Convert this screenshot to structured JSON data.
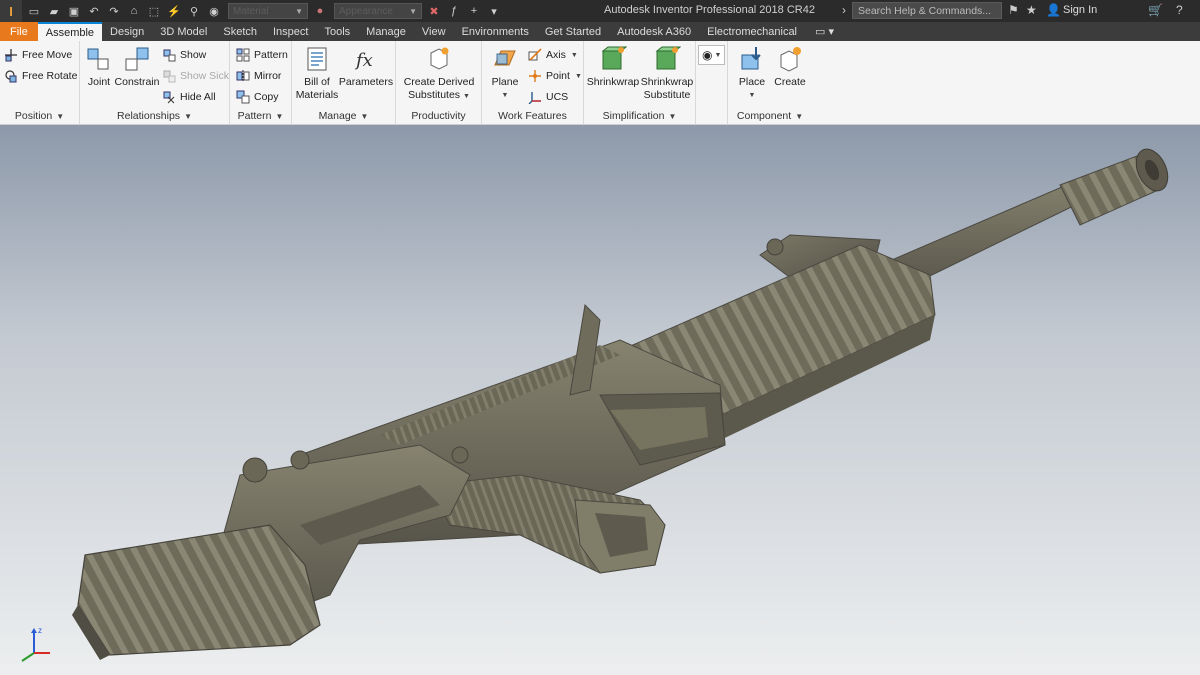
{
  "titlebar": {
    "app_title": "Autodesk Inventor Professional 2018    CR42",
    "search_placeholder": "Search Help & Commands...",
    "signin_label": "Sign In",
    "material_combo": "Material",
    "appearance_combo": "Appearance"
  },
  "tabs": [
    {
      "label": "File"
    },
    {
      "label": "Assemble"
    },
    {
      "label": "Design"
    },
    {
      "label": "3D Model"
    },
    {
      "label": "Sketch"
    },
    {
      "label": "Inspect"
    },
    {
      "label": "Tools"
    },
    {
      "label": "Manage"
    },
    {
      "label": "View"
    },
    {
      "label": "Environments"
    },
    {
      "label": "Get Started"
    },
    {
      "label": "Autodesk A360"
    },
    {
      "label": "Electromechanical"
    }
  ],
  "ribbon": {
    "position": {
      "title": "Position",
      "free_move": "Free Move",
      "free_rotate": "Free Rotate"
    },
    "relationships": {
      "title": "Relationships",
      "joint": "Joint",
      "constrain": "Constrain",
      "show": "Show",
      "show_sick": "Show Sick",
      "hide_all": "Hide All"
    },
    "pattern": {
      "title": "Pattern",
      "pattern": "Pattern",
      "mirror": "Mirror",
      "copy": "Copy"
    },
    "manage": {
      "title": "Manage",
      "bom_1": "Bill of",
      "bom_2": "Materials",
      "parameters": "Parameters"
    },
    "productivity": {
      "title": "Productivity",
      "cds_1": "Create Derived",
      "cds_2": "Substitutes"
    },
    "work_features": {
      "title": "Work Features",
      "plane": "Plane",
      "axis": "Axis",
      "point": "Point",
      "ucs": "UCS"
    },
    "simplification": {
      "title": "Simplification",
      "shrinkwrap": "Shrinkwrap",
      "sws_1": "Shrinkwrap",
      "sws_2": "Substitute"
    },
    "component": {
      "title": "Component",
      "place": "Place",
      "create": "Create"
    }
  },
  "colors": {
    "file_tab": "#e8791c",
    "model": "#6f6c5c",
    "viewport_top": "#8d99aa",
    "viewport_bottom": "#eceeef"
  }
}
